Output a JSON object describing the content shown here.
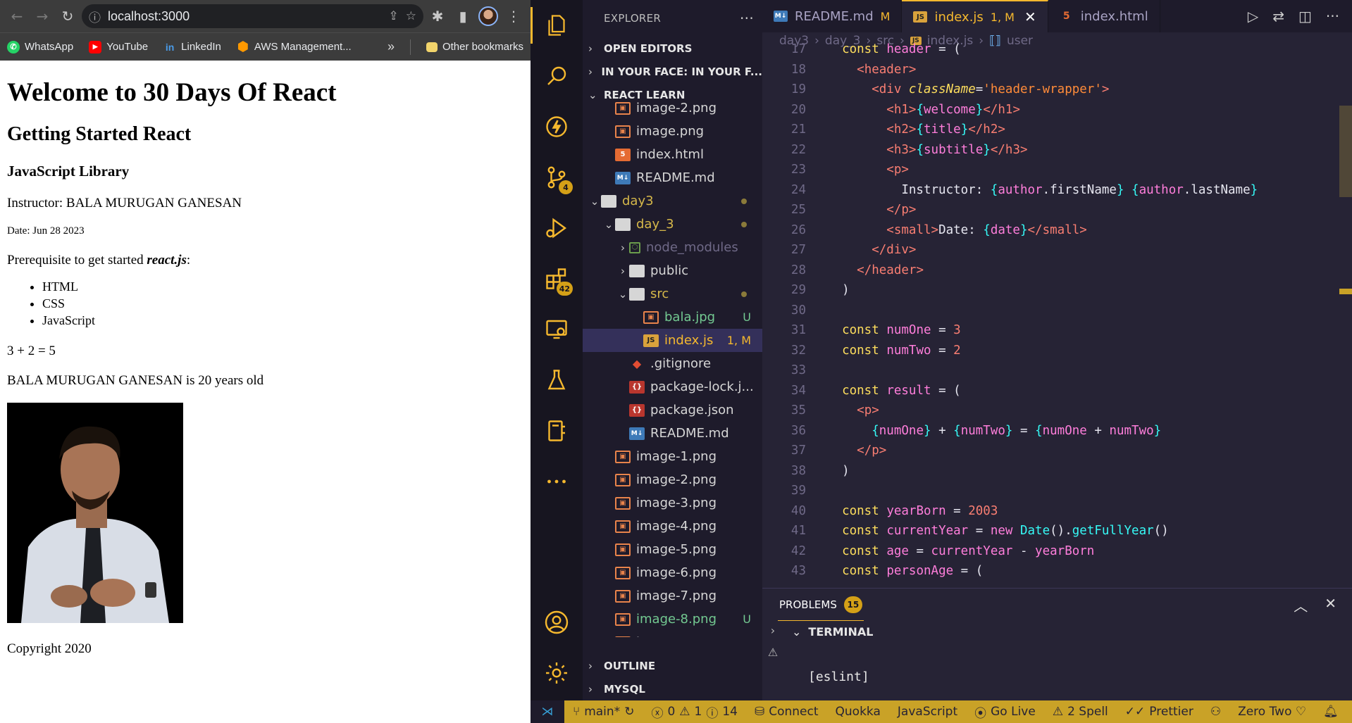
{
  "browser": {
    "url": "localhost:3000",
    "bookmarks": [
      {
        "label": "WhatsApp",
        "color": "#25d366",
        "glyph": "✆"
      },
      {
        "label": "YouTube",
        "color": "#ff0000",
        "glyph": "▶"
      },
      {
        "label": "LinkedIn",
        "color": "#0a66c2",
        "glyph": "in"
      },
      {
        "label": "AWS Management...",
        "color": "#ff9900",
        "glyph": "⬢"
      }
    ],
    "other_bookmarks": "Other bookmarks",
    "page": {
      "h1": "Welcome to 30 Days Of React",
      "h2": "Getting Started React",
      "h3": "JavaScript Library",
      "instructor": "Instructor: BALA MURUGAN GANESAN",
      "date": "Date: Jun 28 2023",
      "prereq_prefix": "Prerequisite to get started ",
      "prereq_em": "react.js",
      "prereq_suffix": ":",
      "skills": [
        "HTML",
        "CSS",
        "JavaScript"
      ],
      "sum": "3 + 2 = 5",
      "age": "BALA MURUGAN GANESAN is 20 years old",
      "copyright": "Copyright 2020"
    }
  },
  "vscode": {
    "explorer_title": "EXPLORER",
    "sections": {
      "open_editors": "OPEN EDITORS",
      "in_your_face": "IN YOUR FACE: IN YOUR F...",
      "react_learn": "REACT LEARN",
      "outline": "OUTLINE",
      "mysql": "MYSQL"
    },
    "badges": {
      "source_control": "4",
      "extensions": "42"
    },
    "tree": [
      {
        "name": "image-2.png",
        "type": "png",
        "indent": 1,
        "clipped": true
      },
      {
        "name": "image.png",
        "type": "png",
        "indent": 1
      },
      {
        "name": "index.html",
        "type": "html",
        "indent": 1
      },
      {
        "name": "README.md",
        "type": "md",
        "indent": 1
      },
      {
        "name": "day3",
        "type": "folder",
        "indent": 0,
        "chevron": "⌄",
        "dot": true,
        "color": "#d6b84a"
      },
      {
        "name": "day_3",
        "type": "folder",
        "indent": 1,
        "chevron": "⌄",
        "dot": true,
        "color": "#d6b84a"
      },
      {
        "name": "node_modules",
        "type": "node",
        "indent": 2,
        "chevron": "›",
        "color": "#6f6987"
      },
      {
        "name": "public",
        "type": "folder",
        "indent": 2,
        "chevron": "›"
      },
      {
        "name": "src",
        "type": "folder",
        "indent": 2,
        "chevron": "⌄",
        "dot": true,
        "color": "#d6b84a"
      },
      {
        "name": "bala.jpg",
        "type": "png",
        "indent": 3,
        "status": "U",
        "color": "#73c991"
      },
      {
        "name": "index.js",
        "type": "js",
        "indent": 3,
        "status": "1, M",
        "color": "#f5b82e",
        "selected": true
      },
      {
        "name": ".gitignore",
        "type": "git",
        "indent": 2
      },
      {
        "name": "package-lock.j...",
        "type": "json",
        "indent": 2
      },
      {
        "name": "package.json",
        "type": "json",
        "indent": 2
      },
      {
        "name": "README.md",
        "type": "md",
        "indent": 2
      },
      {
        "name": "image-1.png",
        "type": "png",
        "indent": 1
      },
      {
        "name": "image-2.png",
        "type": "png",
        "indent": 1
      },
      {
        "name": "image-3.png",
        "type": "png",
        "indent": 1
      },
      {
        "name": "image-4.png",
        "type": "png",
        "indent": 1
      },
      {
        "name": "image-5.png",
        "type": "png",
        "indent": 1
      },
      {
        "name": "image-6.png",
        "type": "png",
        "indent": 1
      },
      {
        "name": "image-7.png",
        "type": "png",
        "indent": 1
      },
      {
        "name": "image-8.png",
        "type": "png",
        "indent": 1,
        "status": "U",
        "color": "#73c991"
      },
      {
        "name": "image.png",
        "type": "png",
        "indent": 1
      }
    ],
    "tabs": [
      {
        "label": "README.md",
        "icon": "md",
        "suffix": "M",
        "active": false
      },
      {
        "label": "index.js",
        "icon": "js",
        "suffix": "1, M",
        "active": true
      },
      {
        "label": "index.html",
        "icon": "html",
        "suffix": "",
        "active": false
      }
    ],
    "breadcrumbs": [
      "day3",
      "day_3",
      "src",
      "index.js",
      "user"
    ],
    "code_start_line": 17,
    "code": [
      [
        [
          "plain",
          "  "
        ],
        [
          "kw",
          "const"
        ],
        [
          "plain",
          " "
        ],
        [
          "var",
          "header"
        ],
        [
          "plain",
          " = ("
        ]
      ],
      [
        [
          "plain",
          "    "
        ],
        [
          "tag",
          "<header>"
        ]
      ],
      [
        [
          "plain",
          "      "
        ],
        [
          "tag",
          "<div"
        ],
        [
          "plain",
          " "
        ],
        [
          "attr",
          "className"
        ],
        [
          "plain",
          "="
        ],
        [
          "str",
          "'header-wrapper'"
        ],
        [
          "tag",
          ">"
        ]
      ],
      [
        [
          "plain",
          "        "
        ],
        [
          "tag",
          "<h1>"
        ],
        [
          "br",
          "{"
        ],
        [
          "var",
          "welcome"
        ],
        [
          "br",
          "}"
        ],
        [
          "tag",
          "</h1>"
        ]
      ],
      [
        [
          "plain",
          "        "
        ],
        [
          "tag",
          "<h2>"
        ],
        [
          "br",
          "{"
        ],
        [
          "var",
          "title"
        ],
        [
          "br",
          "}"
        ],
        [
          "tag",
          "</h2>"
        ]
      ],
      [
        [
          "plain",
          "        "
        ],
        [
          "tag",
          "<h3>"
        ],
        [
          "br",
          "{"
        ],
        [
          "var",
          "subtitle"
        ],
        [
          "br",
          "}"
        ],
        [
          "tag",
          "</h3>"
        ]
      ],
      [
        [
          "plain",
          "        "
        ],
        [
          "tag",
          "<p>"
        ]
      ],
      [
        [
          "plain",
          "          Instructor: "
        ],
        [
          "br",
          "{"
        ],
        [
          "var",
          "author"
        ],
        [
          "plain",
          "."
        ],
        [
          "plain",
          "firstName"
        ],
        [
          "br",
          "}"
        ],
        [
          "plain",
          " "
        ],
        [
          "br",
          "{"
        ],
        [
          "var",
          "author"
        ],
        [
          "plain",
          "."
        ],
        [
          "plain",
          "lastName"
        ],
        [
          "br",
          "}"
        ]
      ],
      [
        [
          "plain",
          "        "
        ],
        [
          "tag",
          "</p>"
        ]
      ],
      [
        [
          "plain",
          "        "
        ],
        [
          "tag",
          "<small>"
        ],
        [
          "plain",
          "Date: "
        ],
        [
          "br",
          "{"
        ],
        [
          "var",
          "date"
        ],
        [
          "br",
          "}"
        ],
        [
          "tag",
          "</small>"
        ]
      ],
      [
        [
          "plain",
          "      "
        ],
        [
          "tag",
          "</div>"
        ]
      ],
      [
        [
          "plain",
          "    "
        ],
        [
          "tag",
          "</header>"
        ]
      ],
      [
        [
          "plain",
          "  )"
        ]
      ],
      [
        [
          "plain",
          ""
        ]
      ],
      [
        [
          "plain",
          "  "
        ],
        [
          "kw",
          "const"
        ],
        [
          "plain",
          " "
        ],
        [
          "var",
          "numOne"
        ],
        [
          "plain",
          " = "
        ],
        [
          "num",
          "3"
        ]
      ],
      [
        [
          "plain",
          "  "
        ],
        [
          "kw",
          "const"
        ],
        [
          "plain",
          " "
        ],
        [
          "var",
          "numTwo"
        ],
        [
          "plain",
          " = "
        ],
        [
          "num",
          "2"
        ]
      ],
      [
        [
          "plain",
          ""
        ]
      ],
      [
        [
          "plain",
          "  "
        ],
        [
          "kw",
          "const"
        ],
        [
          "plain",
          " "
        ],
        [
          "var",
          "result"
        ],
        [
          "plain",
          " = ("
        ]
      ],
      [
        [
          "plain",
          "    "
        ],
        [
          "tag",
          "<p>"
        ]
      ],
      [
        [
          "plain",
          "      "
        ],
        [
          "br",
          "{"
        ],
        [
          "var",
          "numOne"
        ],
        [
          "br",
          "}"
        ],
        [
          "plain",
          " + "
        ],
        [
          "br",
          "{"
        ],
        [
          "var",
          "numTwo"
        ],
        [
          "br",
          "}"
        ],
        [
          "plain",
          " = "
        ],
        [
          "br",
          "{"
        ],
        [
          "var",
          "numOne"
        ],
        [
          "plain",
          " + "
        ],
        [
          "var",
          "numTwo"
        ],
        [
          "br",
          "}"
        ]
      ],
      [
        [
          "plain",
          "    "
        ],
        [
          "tag",
          "</p>"
        ]
      ],
      [
        [
          "plain",
          "  )"
        ]
      ],
      [
        [
          "plain",
          ""
        ]
      ],
      [
        [
          "plain",
          "  "
        ],
        [
          "kw",
          "const"
        ],
        [
          "plain",
          " "
        ],
        [
          "var",
          "yearBorn"
        ],
        [
          "plain",
          " = "
        ],
        [
          "num",
          "2003"
        ]
      ],
      [
        [
          "plain",
          "  "
        ],
        [
          "kw",
          "const"
        ],
        [
          "plain",
          " "
        ],
        [
          "var",
          "currentYear"
        ],
        [
          "plain",
          " = "
        ],
        [
          "kd",
          "new"
        ],
        [
          "plain",
          " "
        ],
        [
          "fn",
          "Date"
        ],
        [
          "plain",
          "()."
        ],
        [
          "fn",
          "getFullYear"
        ],
        [
          "plain",
          "()"
        ]
      ],
      [
        [
          "plain",
          "  "
        ],
        [
          "kw",
          "const"
        ],
        [
          "plain",
          " "
        ],
        [
          "var",
          "age"
        ],
        [
          "plain",
          " = "
        ],
        [
          "var",
          "currentYear"
        ],
        [
          "plain",
          " - "
        ],
        [
          "var",
          "yearBorn"
        ]
      ],
      [
        [
          "plain",
          "  "
        ],
        [
          "kw",
          "const"
        ],
        [
          "plain",
          " "
        ],
        [
          "var",
          "personAge"
        ],
        [
          "plain",
          " = ("
        ]
      ]
    ],
    "panel": {
      "problems_label": "PROBLEMS",
      "problems_count": "15",
      "terminal_label": "TERMINAL",
      "terminal_output": "[eslint]"
    },
    "status": {
      "branch": "main*",
      "errors": "0",
      "warnings": "1",
      "infos": "14",
      "items": [
        "Connect",
        "Quokka",
        "JavaScript",
        "Go Live",
        "2 Spell",
        "Prettier",
        "Zero Two ♡"
      ]
    }
  }
}
